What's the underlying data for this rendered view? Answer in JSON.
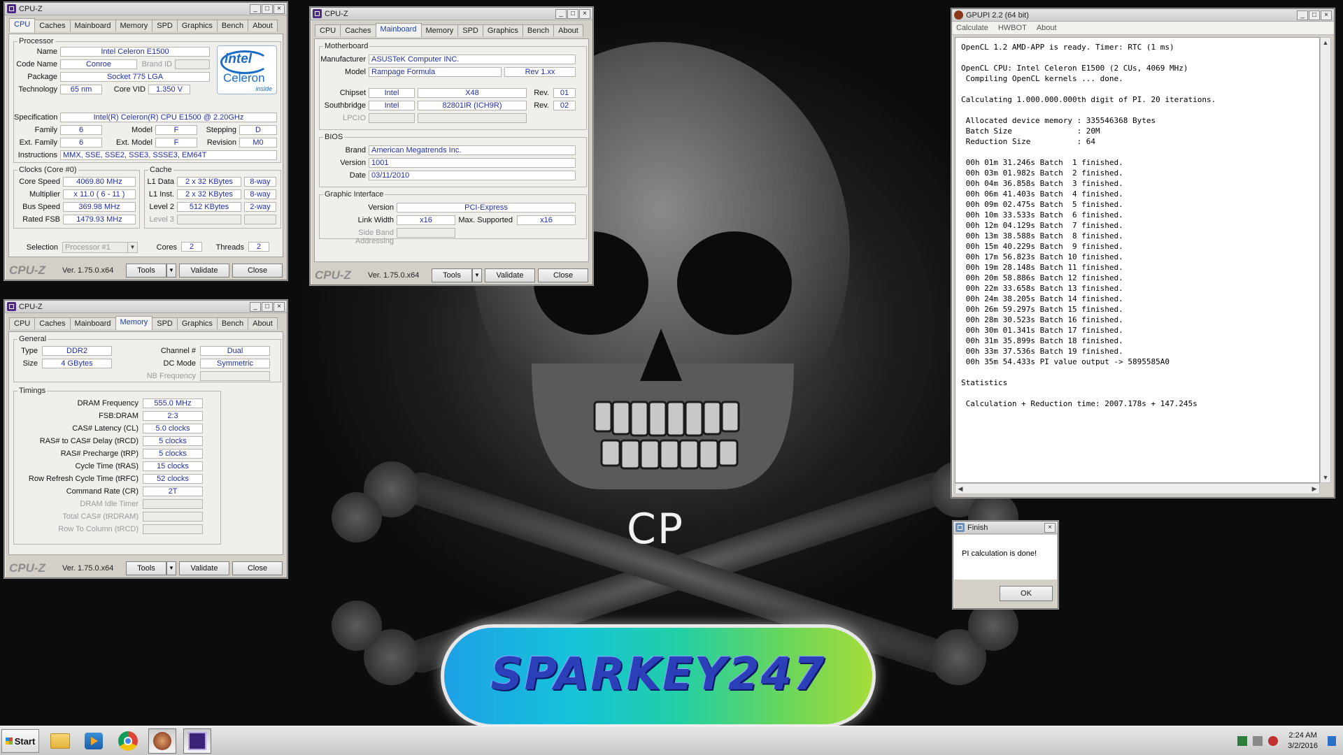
{
  "desktop": {
    "center_text": "CP",
    "badge_text": "SPARKEY247"
  },
  "cpuz_common": {
    "app_title": "CPU-Z",
    "logo": "CPU-Z",
    "version": "Ver. 1.75.0.x64",
    "tools": "Tools",
    "validate": "Validate",
    "close": "Close",
    "tabs": [
      "CPU",
      "Caches",
      "Mainboard",
      "Memory",
      "SPD",
      "Graphics",
      "Bench",
      "About"
    ]
  },
  "cpu": {
    "group_processor": "Processor",
    "name_label": "Name",
    "name": "Intel Celeron E1500",
    "codename_label": "Code Name",
    "codename": "Conroe",
    "brandid_label": "Brand ID",
    "package_label": "Package",
    "package": "Socket 775 LGA",
    "technology_label": "Technology",
    "technology": "65 nm",
    "corevid_label": "Core VID",
    "corevid": "1.350 V",
    "spec_label": "Specification",
    "spec": "Intel(R) Celeron(R) CPU      E1500  @ 2.20GHz",
    "family_label": "Family",
    "family": "6",
    "model_label": "Model",
    "model": "F",
    "stepping_label": "Stepping",
    "stepping": "D",
    "extfamily_label": "Ext. Family",
    "extfamily": "6",
    "extmodel_label": "Ext. Model",
    "extmodel": "F",
    "revision_label": "Revision",
    "revision": "M0",
    "instr_label": "Instructions",
    "instr": "MMX, SSE, SSE2, SSE3, SSSE3, EM64T",
    "logo_brand": "intel",
    "logo_product": "Celeron",
    "logo_tag": "inside",
    "group_clocks": "Clocks (Core #0)",
    "corespeed_label": "Core Speed",
    "corespeed": "4069.80 MHz",
    "multiplier_label": "Multiplier",
    "multiplier": "x 11.0 ( 6 - 11 )",
    "busspeed_label": "Bus Speed",
    "busspeed": "369.98 MHz",
    "ratedfsb_label": "Rated FSB",
    "ratedfsb": "1479.93 MHz",
    "group_cache": "Cache",
    "l1d_label": "L1 Data",
    "l1d": "2 x 32 KBytes",
    "l1d_way": "8-way",
    "l1i_label": "L1 Inst.",
    "l1i": "2 x 32 KBytes",
    "l1i_way": "8-way",
    "l2_label": "Level 2",
    "l2": "512 KBytes",
    "l2_way": "2-way",
    "l3_label": "Level 3",
    "selection_label": "Selection",
    "selection": "Processor #1",
    "cores_label": "Cores",
    "cores": "2",
    "threads_label": "Threads",
    "threads": "2"
  },
  "mainboard": {
    "group_mb": "Motherboard",
    "manufacturer_label": "Manufacturer",
    "manufacturer": "ASUSTeK Computer INC.",
    "model_label": "Model",
    "model": "Rampage Formula",
    "model_rev": "Rev 1.xx",
    "chipset_label": "Chipset",
    "chipset_vendor": "Intel",
    "chipset": "X48",
    "chipset_rev_label": "Rev.",
    "chipset_rev": "01",
    "south_label": "Southbridge",
    "south_vendor": "Intel",
    "south": "82801IR (ICH9R)",
    "south_rev_label": "Rev.",
    "south_rev": "02",
    "lpcio_label": "LPCIO",
    "group_bios": "BIOS",
    "brand_label": "Brand",
    "brand": "American Megatrends Inc.",
    "version_label": "Version",
    "version": "1001",
    "date_label": "Date",
    "date": "03/11/2010",
    "group_gi": "Graphic Interface",
    "gi_version_label": "Version",
    "gi_version": "PCI-Express",
    "linkwidth_label": "Link Width",
    "linkwidth": "x16",
    "maxsup_label": "Max. Supported",
    "maxsup": "x16",
    "sideband_label": "Side Band Addressing"
  },
  "memory": {
    "group_general": "General",
    "type_label": "Type",
    "type": "DDR2",
    "channel_label": "Channel #",
    "channel": "Dual",
    "size_label": "Size",
    "size": "4 GBytes",
    "dcmode_label": "DC Mode",
    "dcmode": "Symmetric",
    "nbfreq_label": "NB Frequency",
    "group_timings": "Timings",
    "timings": [
      {
        "label": "DRAM Frequency",
        "value": "555.0 MHz",
        "dim": false
      },
      {
        "label": "FSB:DRAM",
        "value": "2:3",
        "dim": false
      },
      {
        "label": "CAS# Latency (CL)",
        "value": "5.0 clocks",
        "dim": false
      },
      {
        "label": "RAS# to CAS# Delay (tRCD)",
        "value": "5 clocks",
        "dim": false
      },
      {
        "label": "RAS# Precharge (tRP)",
        "value": "5 clocks",
        "dim": false
      },
      {
        "label": "Cycle Time (tRAS)",
        "value": "15 clocks",
        "dim": false
      },
      {
        "label": "Row Refresh Cycle Time (tRFC)",
        "value": "52 clocks",
        "dim": false
      },
      {
        "label": "Command Rate (CR)",
        "value": "2T",
        "dim": false
      },
      {
        "label": "DRAM Idle Timer",
        "value": "",
        "dim": true
      },
      {
        "label": "Total CAS# (tRDRAM)",
        "value": "",
        "dim": true
      },
      {
        "label": "Row To Column (tRCD)",
        "value": "",
        "dim": true
      }
    ]
  },
  "gpupi": {
    "title": "GPUPI 2.2 (64 bit)",
    "menu": [
      "Calculate",
      "HWBOT",
      "About"
    ],
    "lines": [
      "OpenCL 1.2 AMD-APP is ready. Timer: RTC (1 ms)",
      "",
      "OpenCL CPU: Intel Celeron E1500 (2 CUs, 4069 MHz)",
      " Compiling OpenCL kernels ... done.",
      "",
      "Calculating 1.000.000.000th digit of PI. 20 iterations.",
      "",
      " Allocated device memory : 335546368 Bytes",
      " Batch Size              : 20M",
      " Reduction Size          : 64",
      "",
      " 00h 01m 31.246s Batch  1 finished.",
      " 00h 03m 01.982s Batch  2 finished.",
      " 00h 04m 36.858s Batch  3 finished.",
      " 00h 06m 41.403s Batch  4 finished.",
      " 00h 09m 02.475s Batch  5 finished.",
      " 00h 10m 33.533s Batch  6 finished.",
      " 00h 12m 04.129s Batch  7 finished.",
      " 00h 13m 38.588s Batch  8 finished.",
      " 00h 15m 40.229s Batch  9 finished.",
      " 00h 17m 56.823s Batch 10 finished.",
      " 00h 19m 28.148s Batch 11 finished.",
      " 00h 20m 58.886s Batch 12 finished.",
      " 00h 22m 33.658s Batch 13 finished.",
      " 00h 24m 38.205s Batch 14 finished.",
      " 00h 26m 59.297s Batch 15 finished.",
      " 00h 28m 30.523s Batch 16 finished.",
      " 00h 30m 01.341s Batch 17 finished.",
      " 00h 31m 35.899s Batch 18 finished.",
      " 00h 33m 37.536s Batch 19 finished.",
      " 00h 35m 54.433s PI value output -> 5895585A0",
      "",
      "Statistics",
      "",
      " Calculation + Reduction time: 2007.178s + 147.245s"
    ]
  },
  "finish": {
    "title": "Finish",
    "message": "PI calculation is done!",
    "ok": "OK"
  },
  "taskbar": {
    "start": "Start",
    "time": "2:24 AM",
    "date": "3/2/2016"
  }
}
